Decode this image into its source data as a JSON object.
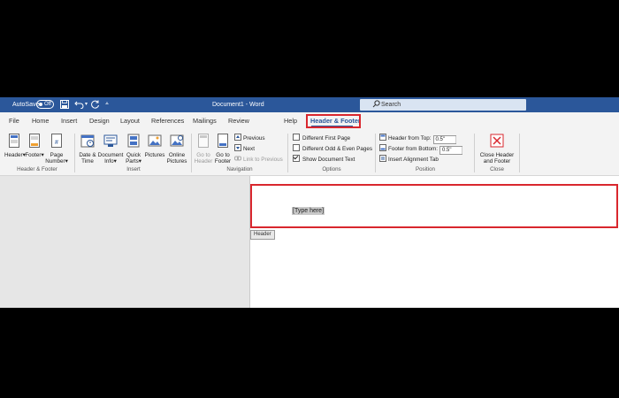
{
  "titlebar": {
    "autosave_label": "AutoSave",
    "autosave_state": "Off",
    "doc_title": "Document1 - Word",
    "search_placeholder": "Search"
  },
  "tabs": [
    "File",
    "Home",
    "Insert",
    "Design",
    "Layout",
    "References",
    "Mailings",
    "Review",
    "Help",
    "Header & Footer"
  ],
  "active_tab": "Header & Footer",
  "ribbon": {
    "header_footer_group": {
      "label": "Header & Footer",
      "header": "Header",
      "footer": "Footer",
      "page_number_1": "Page",
      "page_number_2": "Number"
    },
    "insert_group": {
      "label": "Insert",
      "date_time_1": "Date &",
      "date_time_2": "Time",
      "document_info_1": "Document",
      "document_info_2": "Info",
      "quick_parts_1": "Quick",
      "quick_parts_2": "Parts",
      "pictures": "Pictures",
      "online_pictures_1": "Online",
      "online_pictures_2": "Pictures"
    },
    "navigation_group": {
      "label": "Navigation",
      "go_to_header_1": "Go to",
      "go_to_header_2": "Header",
      "go_to_footer_1": "Go to",
      "go_to_footer_2": "Footer",
      "previous": "Previous",
      "next": "Next",
      "link_to_previous": "Link to Previous"
    },
    "options_group": {
      "label": "Options",
      "different_first_page": "Different First Page",
      "different_odd_even": "Different Odd & Even Pages",
      "show_document_text": "Show Document Text"
    },
    "position_group": {
      "label": "Position",
      "header_from_top": "Header from Top:",
      "header_from_top_value": "0.5\"",
      "footer_from_bottom": "Footer from Bottom:",
      "footer_from_bottom_value": "0.5\"",
      "insert_alignment_tab": "Insert Alignment Tab"
    },
    "close_group": {
      "label": "Close",
      "close_1": "Close Header",
      "close_2": "and Footer"
    }
  },
  "document": {
    "placeholder": "[Type here]",
    "header_tag": "Header"
  },
  "colors": {
    "titlebar": "#2b579a",
    "highlight": "#d9272e"
  }
}
